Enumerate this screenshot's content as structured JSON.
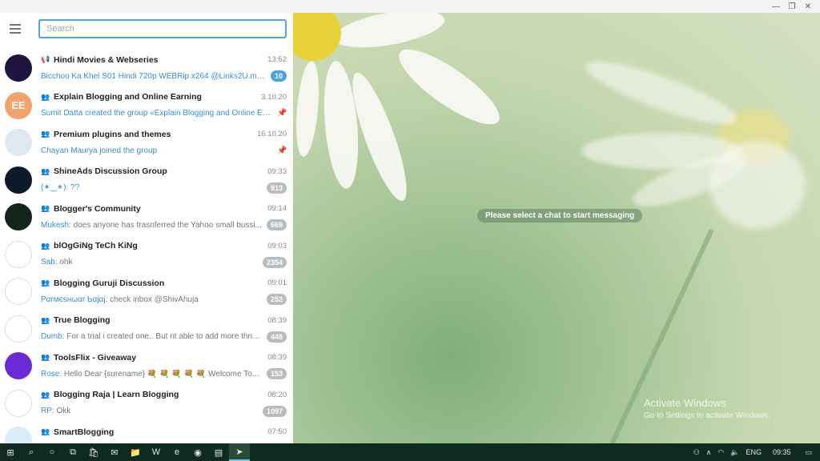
{
  "window": {
    "minimize_icon": "minimize-icon",
    "restore_icon": "restore-icon",
    "close_icon": "close-icon"
  },
  "search": {
    "placeholder": "Search"
  },
  "chats": [
    {
      "type": "channel",
      "name": "Hindi Movies & Webseries",
      "time": "13:52",
      "sender": "",
      "preview": "Bicchoo Ka Khel S01 Hindi 720p WEBRip x264 @Links2U.mkv, B...",
      "badge": "10",
      "badge_active": true,
      "pinned": false,
      "avatar_text": "",
      "avatar_color": "#1f1540"
    },
    {
      "type": "group",
      "name": "Explain Blogging and Online Earning",
      "time": "3.10.20",
      "sender": "",
      "preview": "Sumit Datta created the group «Explain Blogging and Online Ea...",
      "badge": "",
      "pinned": true,
      "avatar_text": "EE",
      "avatar_color": "#f3a26b"
    },
    {
      "type": "group",
      "name": "Premium plugins and themes",
      "time": "16.10.20",
      "sender": "",
      "preview": "Chayan Maurya joined the group",
      "badge": "",
      "pinned": true,
      "avatar_text": "",
      "avatar_color": "#dfe8f1"
    },
    {
      "type": "group",
      "name": "ShineAds Discussion Group",
      "time": "09:33",
      "sender": "",
      "preview": "(✶‿✶): ??",
      "badge": "913",
      "pinned": false,
      "avatar_text": "",
      "avatar_color": "#0e1a2a"
    },
    {
      "type": "group",
      "name": "Blogger's Community",
      "time": "09:14",
      "sender": "Mukesh",
      "preview": "does anyone  has trasnferred the Yahoo small bussi...",
      "badge": "669",
      "pinned": false,
      "avatar_text": "",
      "avatar_color": "#13241b"
    },
    {
      "type": "group",
      "name": "blOgGiNg TeCh KiNg",
      "time": "09:03",
      "sender": "Sab",
      "preview": "ohk",
      "badge": "2354",
      "pinned": false,
      "avatar_text": "",
      "avatar_color": "#ffffff"
    },
    {
      "type": "group",
      "name": "Blogging Guruji Discussion",
      "time": "09:01",
      "sender": "Pαrмєѕнωαr Ƅαjαj",
      "preview": "check inbox @ShivAhuja",
      "badge": "252",
      "pinned": false,
      "avatar_text": "",
      "avatar_color": "#ffffff"
    },
    {
      "type": "group",
      "name": "True Blogging",
      "time": "08:39",
      "sender": "Dumb",
      "preview": "For a trial i created one.. But nt able to add more thn 2...",
      "badge": "448",
      "pinned": false,
      "avatar_text": "",
      "avatar_color": "#ffffff"
    },
    {
      "type": "group",
      "name": "ToolsFlix - Giveaway",
      "time": "08:39",
      "sender": "Rose",
      "preview": "Hello Dear {surename} 💐 💐 💐 💐 💐  Welcome To T...",
      "badge": "153",
      "pinned": false,
      "avatar_text": "",
      "avatar_color": "#6a2bd6"
    },
    {
      "type": "group",
      "name": "Blogging Raja | Learn Blogging",
      "time": "08:20",
      "sender": "RP",
      "preview": "Okk",
      "badge": "1097",
      "pinned": false,
      "avatar_text": "",
      "avatar_color": "#ffffff"
    },
    {
      "type": "group",
      "name": "SmartBlogging",
      "time": "07:50",
      "sender": "",
      "preview": "",
      "badge": "",
      "pinned": false,
      "avatar_text": "",
      "avatar_color": "#d9ecf7"
    }
  ],
  "main": {
    "empty_message": "Please select a chat to start messaging",
    "watermark_title": "Activate Windows",
    "watermark_sub": "Go to Settings to activate Windows."
  },
  "taskbar": {
    "icons": [
      "windows-start-icon",
      "search-icon",
      "cortana-icon",
      "task-view-icon",
      "store-icon",
      "mail-icon",
      "file-explorer-icon",
      "word-icon",
      "edge-icon",
      "chrome-icon",
      "notes-icon",
      "telegram-icon"
    ],
    "tray": {
      "lang": "ENG",
      "time": "09:35"
    }
  },
  "colors": {
    "accent": "#54a3d9",
    "badge_active": "#4ea4e0",
    "badge_muted": "#b9bdc0",
    "taskbar": "#0f2a1f"
  }
}
